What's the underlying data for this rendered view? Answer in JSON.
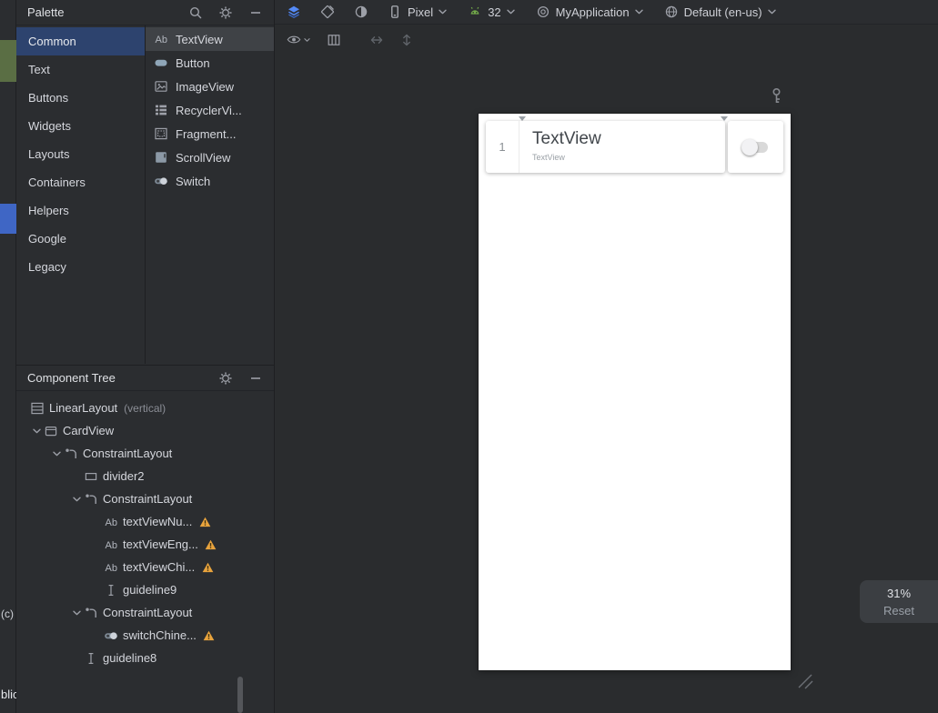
{
  "left_strip": {
    "fragments": [
      "(c)",
      "blic"
    ]
  },
  "palette": {
    "title": "Palette",
    "categories": [
      {
        "label": "Common",
        "selected": true
      },
      {
        "label": "Text"
      },
      {
        "label": "Buttons"
      },
      {
        "label": "Widgets"
      },
      {
        "label": "Layouts"
      },
      {
        "label": "Containers"
      },
      {
        "label": "Helpers"
      },
      {
        "label": "Google"
      },
      {
        "label": "Legacy"
      }
    ],
    "components": [
      {
        "label": "TextView",
        "icon": "textview-icon",
        "selected": true
      },
      {
        "label": "Button",
        "icon": "button-icon"
      },
      {
        "label": "ImageView",
        "icon": "imageview-icon"
      },
      {
        "label": "RecyclerVi...",
        "icon": "recyclerview-icon"
      },
      {
        "label": "Fragment...",
        "icon": "fragment-icon"
      },
      {
        "label": "ScrollView",
        "icon": "scrollview-icon"
      },
      {
        "label": "Switch",
        "icon": "switch-icon"
      }
    ]
  },
  "main_toolbar": {
    "mode_icons": [
      "layers-icon",
      "blueprint-eraser-icon",
      "theme-mode-icon"
    ],
    "device": {
      "icon": "phone-icon",
      "label": "Pixel"
    },
    "api": {
      "icon": "android-icon",
      "label": "32"
    },
    "app_theme": {
      "icon": "app-circle-icon",
      "label": "MyApplication"
    },
    "locale": {
      "icon": "globe-icon",
      "label": "Default (en-us)"
    }
  },
  "sub_toolbar": {
    "icons": [
      "eye-icon",
      "split-columns-icon",
      "swap-horizontal-icon",
      "swap-vertical-icon"
    ]
  },
  "component_tree": {
    "title": "Component Tree",
    "nodes": [
      {
        "label": "LinearLayout",
        "suffix": "(vertical)",
        "depth": 0,
        "icon": "linearlayout-icon"
      },
      {
        "label": "CardView",
        "depth": 1,
        "icon": "cardview-icon",
        "expanded": true
      },
      {
        "label": "ConstraintLayout",
        "depth": 2,
        "icon": "constraintlayout-icon",
        "expanded": true
      },
      {
        "label": "divider2",
        "depth": 3,
        "icon": "view-icon"
      },
      {
        "label": "ConstraintLayout",
        "depth": 3,
        "icon": "constraintlayout-icon",
        "expanded": true
      },
      {
        "label": "textViewNu...",
        "depth": 4,
        "icon": "textview-icon",
        "warning": true
      },
      {
        "label": "textViewEng...",
        "depth": 4,
        "icon": "textview-icon",
        "warning": true
      },
      {
        "label": "textViewChi...",
        "depth": 4,
        "icon": "textview-icon",
        "warning": true
      },
      {
        "label": "guideline9",
        "depth": 4,
        "icon": "guideline-icon"
      },
      {
        "label": "ConstraintLayout",
        "depth": 3,
        "icon": "constraintlayout-icon",
        "expanded": true
      },
      {
        "label": "switchChine...",
        "depth": 4,
        "icon": "switch-icon",
        "warning": true
      },
      {
        "label": "guideline8",
        "depth": 3,
        "icon": "guideline-icon"
      }
    ]
  },
  "preview": {
    "row_number": "1",
    "title": "TextView",
    "subtitle": "TextView"
  },
  "zoom_controls": {
    "percent": "31%",
    "reset_label": "Reset"
  },
  "colors": {
    "selection_blue": "#2d436e",
    "warning_yellow": "#e8a33d",
    "layers_blue": "#548af7",
    "android_green": "#72a94a"
  }
}
